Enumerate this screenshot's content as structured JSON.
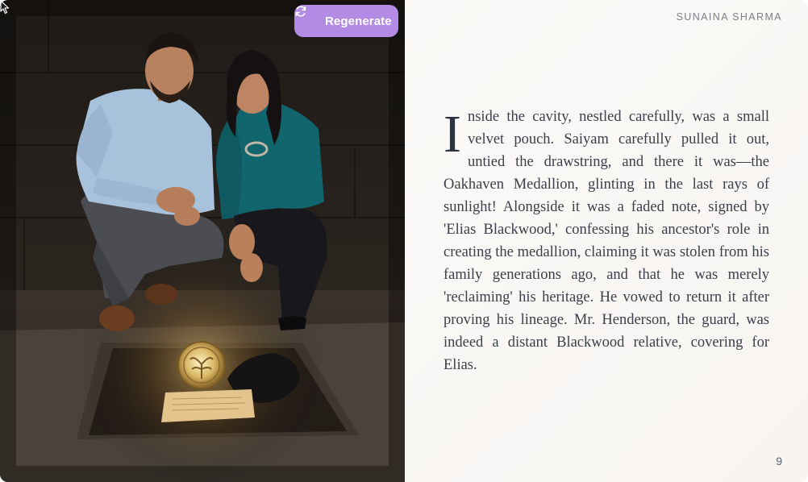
{
  "toolbar": {
    "regenerate_label": "Regenerate",
    "regenerate_icon": "refresh-icon",
    "button_color": "#b48be4"
  },
  "page": {
    "author": "SUNAINA SHARMA",
    "drop_cap": "I",
    "story_text": "nside the cavity, nestled carefully, was a small velvet pouch. Saiyam carefully pulled it out, untied the drawstring, and there it was—the Oakhaven Medallion, glinting in the last rays of sunlight! Alongside it was a faded note, signed by 'Elias Blackwood,' confessing his ancestor's role in creating the medallion, claiming it was stolen from his family generations ago, and that he was merely 'reclaiming' his heritage. He vowed to return it after proving his lineage. Mr. Henderson, the guard, was indeed a distant Blackwood relative, covering for Elias.",
    "page_number": "9"
  },
  "illustration": {
    "subject": "couple-kneeling-by-pit-with-glowing-medallion-image"
  }
}
